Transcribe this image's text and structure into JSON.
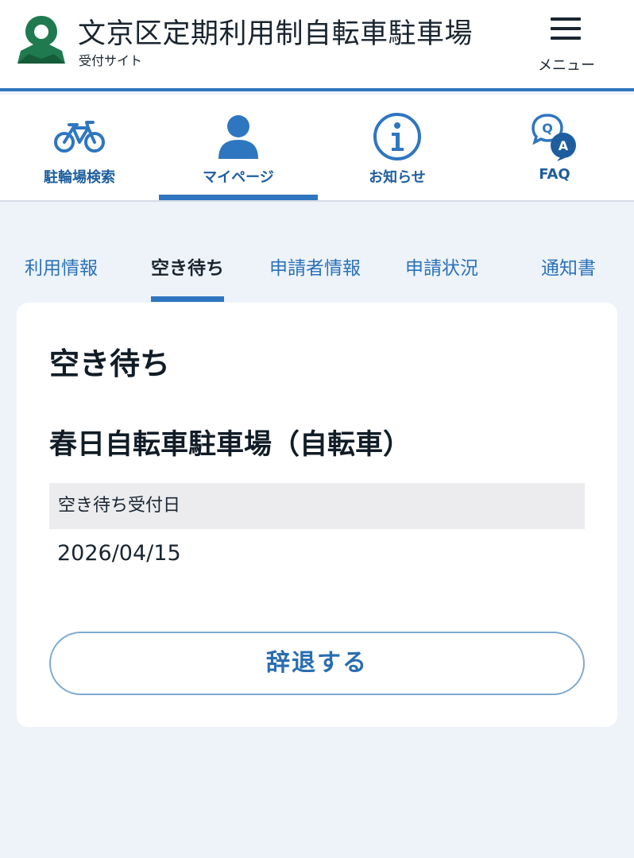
{
  "header": {
    "title": "文京区定期利用制自転車駐車場",
    "subtitle": "受付サイト",
    "menu_label": "メニュー"
  },
  "main_nav": [
    {
      "label": "駐輪場検索",
      "icon": "bicycle-icon"
    },
    {
      "label": "マイページ",
      "icon": "person-icon",
      "active": true
    },
    {
      "label": "お知らせ",
      "icon": "info-icon"
    },
    {
      "label": "FAQ",
      "icon": "faq-icon"
    }
  ],
  "sub_tabs": [
    {
      "label": "利用情報"
    },
    {
      "label": "空き待ち",
      "active": true
    },
    {
      "label": "申請者情報"
    },
    {
      "label": "申請状況"
    },
    {
      "label": "通知書"
    }
  ],
  "card": {
    "title": "空き待ち",
    "lot_name": "春日自転車駐車場（自転車）",
    "field_label": "空き待ち受付日",
    "field_value": "2026/04/15",
    "withdraw_label": "辞退する"
  },
  "colors": {
    "accent": "#2f76c0",
    "nav_label": "#1e5e9e",
    "logo_green": "#1f7a4f",
    "page_bg": "#eef3f9"
  }
}
